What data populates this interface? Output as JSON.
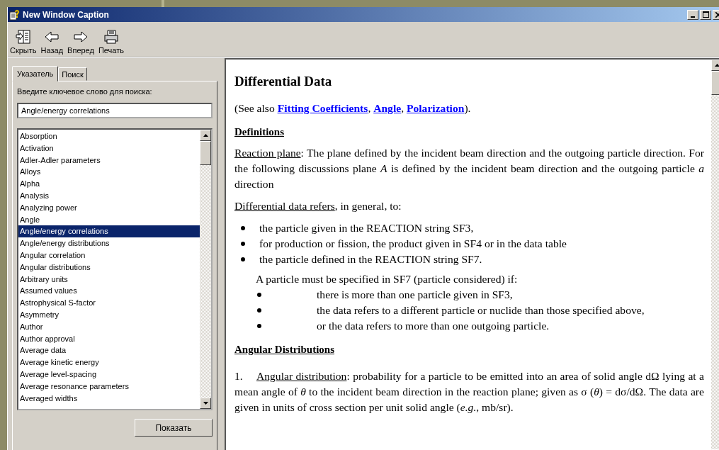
{
  "window": {
    "title": "New Window Caption"
  },
  "toolbar": [
    {
      "kind": "hide",
      "label": "Скрыть"
    },
    {
      "kind": "back",
      "label": "Назад"
    },
    {
      "kind": "forward",
      "label": "Вперед"
    },
    {
      "kind": "print",
      "label": "Печать"
    }
  ],
  "tabs": [
    {
      "label": "Указатель",
      "selected": true
    },
    {
      "label": "Поиск",
      "selected": false
    }
  ],
  "index": {
    "prompt": "Введите ключевое слово для поиска:",
    "value": "Angle/energy correlations",
    "items": [
      {
        "label": "Absorption",
        "selected": false
      },
      {
        "label": "Activation",
        "selected": false
      },
      {
        "label": "Adler-Adler parameters",
        "selected": false
      },
      {
        "label": "Alloys",
        "selected": false
      },
      {
        "label": "Alpha",
        "selected": false
      },
      {
        "label": "Analysis",
        "selected": false
      },
      {
        "label": "Analyzing power",
        "selected": false
      },
      {
        "label": "Angle",
        "selected": false
      },
      {
        "label": "Angle/energy correlations",
        "selected": true
      },
      {
        "label": "Angle/energy distributions",
        "selected": false
      },
      {
        "label": "Angular correlation",
        "selected": false
      },
      {
        "label": "Angular distributions",
        "selected": false
      },
      {
        "label": "Arbitrary units",
        "selected": false
      },
      {
        "label": "Assumed values",
        "selected": false
      },
      {
        "label": "Astrophysical S-factor",
        "selected": false
      },
      {
        "label": "Asymmetry",
        "selected": false
      },
      {
        "label": "Author",
        "selected": false
      },
      {
        "label": "Author approval",
        "selected": false
      },
      {
        "label": "Average data",
        "selected": false
      },
      {
        "label": "Average kinetic energy",
        "selected": false
      },
      {
        "label": "Average level-spacing",
        "selected": false
      },
      {
        "label": "Average resonance parameters",
        "selected": false
      },
      {
        "label": "Averaged widths",
        "selected": false
      }
    ],
    "button": "Показать"
  },
  "content": [
    {
      "kind": "title",
      "text": "Differential Data"
    },
    {
      "kind": "links",
      "parts": [
        {
          "kind": "text",
          "text": "(See also "
        },
        {
          "kind": "link",
          "text": "Fitting Coefficients"
        },
        {
          "kind": "text",
          "text": ", "
        },
        {
          "kind": "link",
          "text": "Angle"
        },
        {
          "kind": "text",
          "text": ", "
        },
        {
          "kind": "link",
          "text": "Polarization"
        },
        {
          "kind": "text",
          "text": ")."
        }
      ]
    },
    {
      "kind": "heading",
      "text": "Definitions"
    },
    {
      "kind": "para",
      "term": "Reaction plane",
      "text": ": The plane defined by the incident beam direction and the outgoing particle direction.  For the following discussions plane *A* is defined by the incident beam direction and the outgoing particle *a* direction"
    },
    {
      "kind": "para",
      "term": "Differential data refers",
      "text": ", in general, to:"
    },
    {
      "kind": "bullets",
      "items": [
        "the particle given in the REACTION string SF3,",
        "for production or fission, the product given in SF4 or in the data table",
        "the particle defined in the REACTION string SF7."
      ]
    },
    {
      "kind": "subpara",
      "text": "A particle must be specified in SF7 (particle considered) if:"
    },
    {
      "kind": "subbullets",
      "items": [
        "there is more than one particle given in SF3,",
        "the data refers to a different particle or nuclide than those specified above,",
        "or the data refers to more than one outgoing particle."
      ]
    },
    {
      "kind": "heading",
      "text": "Angular Distributions "
    },
    {
      "kind": "numbered",
      "number": "1.",
      "term": "Angular distribution",
      "text": ": probability for a particle to be emitted into an area of solid angle dΩ lying at a mean angle of *θ* to the incident beam direction in the reaction plane; given as σ (*θ*) = dσ/dΩ.  The data are given in units of cross section per unit solid angle (*e.g.*, mb/sr)."
    }
  ]
}
